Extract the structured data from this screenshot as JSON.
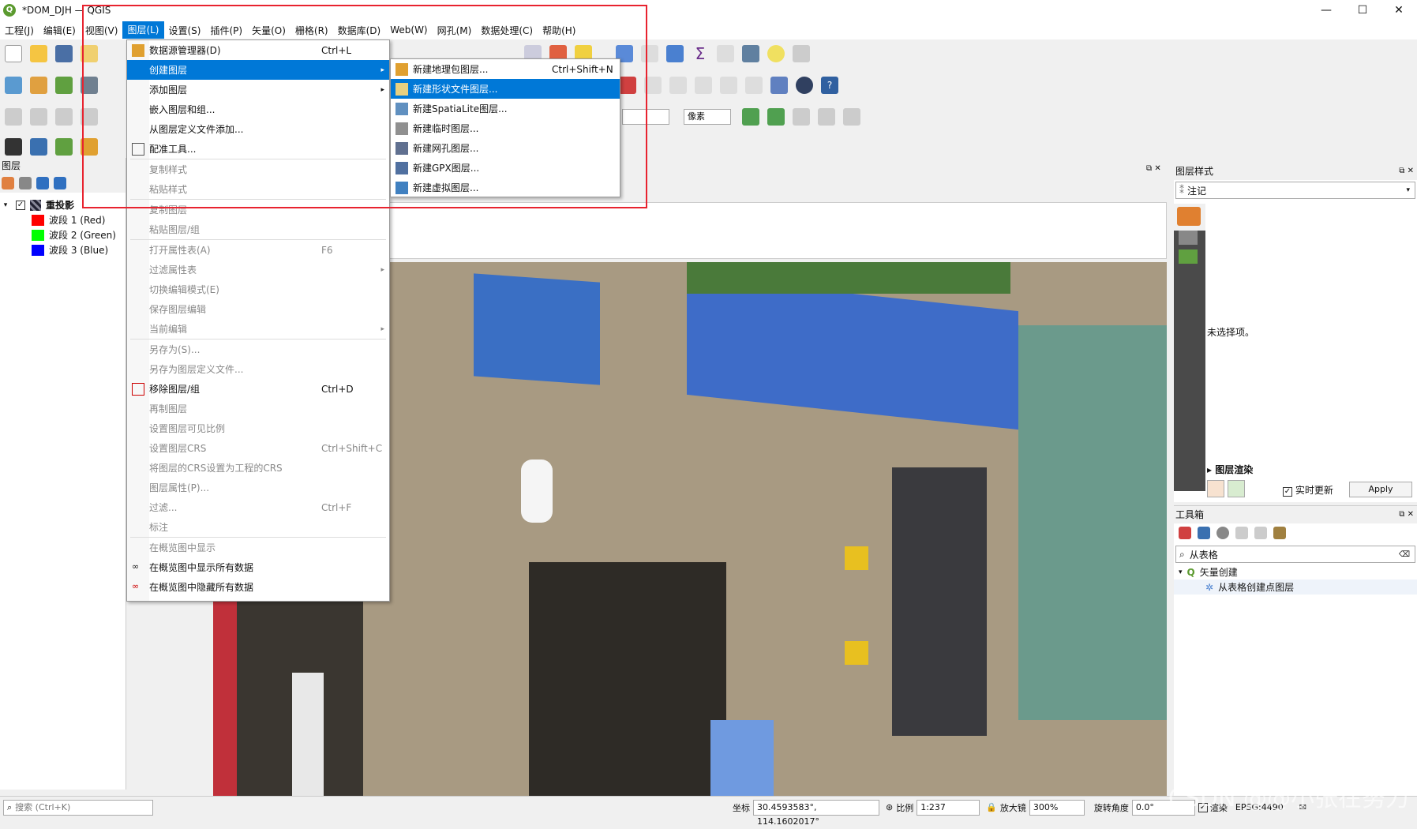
{
  "window": {
    "title": "*DOM_DJH — QGIS",
    "min": "—",
    "max": "☐",
    "close": "✕"
  },
  "menubar": [
    "工程(J)",
    "编辑(E)",
    "视图(V)",
    "图层(L)",
    "设置(S)",
    "插件(P)",
    "矢量(O)",
    "栅格(R)",
    "数据库(D)",
    "Web(W)",
    "网孔(M)",
    "数据处理(C)",
    "帮助(H)"
  ],
  "layers_panel": {
    "title": "图层",
    "group": "重投影",
    "bands": [
      {
        "label": "波段 1 (Red)",
        "color": "#ff0000"
      },
      {
        "label": "波段 2 (Green)",
        "color": "#00ff00"
      },
      {
        "label": "波段 3 (Blue)",
        "color": "#0000ff"
      }
    ]
  },
  "layer_menu": {
    "items": [
      {
        "label": "数据源管理器(D)",
        "shortcut": "Ctrl+L",
        "disabled": false
      },
      {
        "label": "创建图层",
        "submenu": true,
        "highlight": true
      },
      {
        "label": "添加图层",
        "submenu": true
      },
      {
        "label": "嵌入图层和组..."
      },
      {
        "label": "从图层定义文件添加..."
      },
      {
        "label": "配准工具..."
      },
      {
        "sep": true
      },
      {
        "label": "复制样式",
        "disabled": true
      },
      {
        "label": "粘贴样式",
        "disabled": true
      },
      {
        "sep": true
      },
      {
        "label": "复制图层",
        "disabled": true
      },
      {
        "label": "粘贴图层/组",
        "disabled": true
      },
      {
        "sep": true
      },
      {
        "label": "打开属性表(A)",
        "shortcut": "F6",
        "disabled": true
      },
      {
        "label": "过滤属性表",
        "submenu": true,
        "disabled": true
      },
      {
        "label": "切换编辑模式(E)",
        "disabled": true
      },
      {
        "label": "保存图层编辑",
        "disabled": true
      },
      {
        "label": "当前编辑",
        "submenu": true,
        "disabled": true
      },
      {
        "sep": true
      },
      {
        "label": "另存为(S)...",
        "disabled": true
      },
      {
        "label": "另存为图层定义文件...",
        "disabled": true
      },
      {
        "label": "移除图层/组",
        "shortcut": "Ctrl+D"
      },
      {
        "label": "再制图层",
        "disabled": true
      },
      {
        "label": "设置图层可见比例",
        "disabled": true
      },
      {
        "label": "设置图层CRS",
        "shortcut": "Ctrl+Shift+C",
        "disabled": true
      },
      {
        "label": "将图层的CRS设置为工程的CRS",
        "disabled": true
      },
      {
        "label": "图层属性(P)...",
        "disabled": true
      },
      {
        "label": "过滤...",
        "shortcut": "Ctrl+F",
        "disabled": true
      },
      {
        "label": "标注",
        "disabled": true
      },
      {
        "sep": true
      },
      {
        "label": "在概览图中显示",
        "disabled": true
      },
      {
        "label": "在概览图中显示所有数据"
      },
      {
        "label": "在概览图中隐藏所有数据"
      }
    ]
  },
  "create_submenu": {
    "items": [
      {
        "label": "新建地理包图层...",
        "shortcut": "Ctrl+Shift+N"
      },
      {
        "label": "新建形状文件图层...",
        "highlight": true
      },
      {
        "label": "新建SpatiaLite图层..."
      },
      {
        "label": "新建临时图层..."
      },
      {
        "label": "新建网孔图层..."
      },
      {
        "label": "新建GPX图层..."
      },
      {
        "label": "新建虚拟图层..."
      }
    ]
  },
  "toolbar_extra": {
    "units": "像素"
  },
  "style_panel": {
    "title": "图层样式",
    "combo": "注记",
    "empty": "未选择项。",
    "render": "图层渲染",
    "live_update": "实时更新",
    "apply": "Apply"
  },
  "toolbox": {
    "title": "工具箱",
    "search": "从表格",
    "group": "矢量创建",
    "item": "从表格创建点图层"
  },
  "statusbar": {
    "search_placeholder": "搜索 (Ctrl+K)",
    "coord_label": "坐标",
    "coord": "30.4593583°, 114.1602017°",
    "scale_label": "比例",
    "scale": "1:237",
    "mag_label": "放大镜",
    "mag": "300%",
    "rot_label": "旋转角度",
    "rot": "0.0°",
    "render": "渲染",
    "crs": "EPSG:4490"
  },
  "watermark": "CSDN @@小张在努力"
}
